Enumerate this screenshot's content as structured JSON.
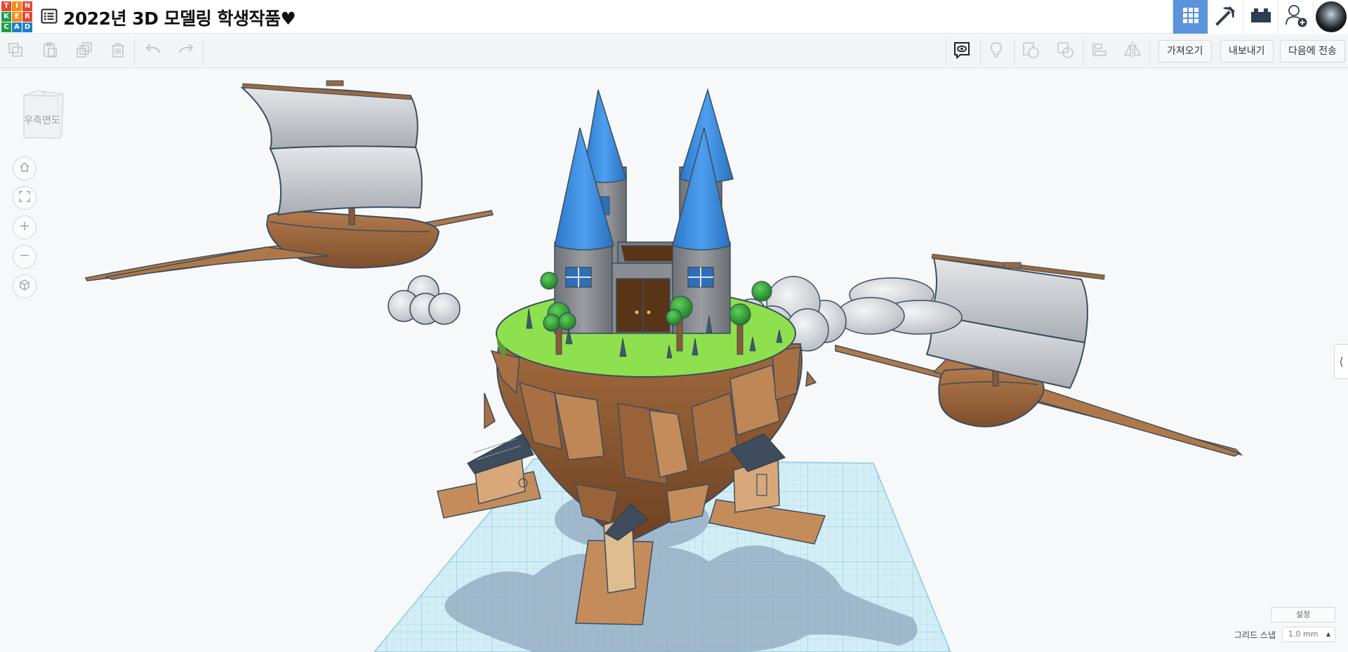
{
  "app": {
    "logo_letters": [
      "T",
      "I",
      "N",
      "K",
      "E",
      "R",
      "C",
      "A",
      "D"
    ],
    "logo_colors": [
      "#e8442f",
      "#f28c1e",
      "#e8442f",
      "#1f9e4a",
      "#f28c1e",
      "#e8442f",
      "#1f9e4a",
      "#1e7fc4",
      "#1e7fc4"
    ],
    "document_title": "2022년 3D 모델링 학생작품♥"
  },
  "top_right": {
    "items": [
      {
        "name": "3d-design-view",
        "icon": "grid-icon",
        "active": true
      },
      {
        "name": "blocks-view",
        "icon": "pickaxe-icon",
        "active": false
      },
      {
        "name": "bricks-view",
        "icon": "brick-icon",
        "active": false
      },
      {
        "name": "add-user",
        "icon": "add-user-icon",
        "active": false
      }
    ]
  },
  "toolbar": {
    "left_icons": [
      "copy-icon",
      "paste-icon",
      "duplicate-icon",
      "delete-icon",
      "undo-icon",
      "redo-icon"
    ],
    "right_icons": [
      "show-notes-icon",
      "light-bulb-icon",
      "shape-icon",
      "group-icon",
      "align-icon",
      "mirror-icon"
    ],
    "import_label": "가져오기",
    "export_label": "내보내기",
    "send_to_label": "다음에 전송"
  },
  "workplane": {
    "view_cube_label": "우측면도",
    "nav_buttons": [
      "home-icon",
      "fit-view-icon",
      "zoom-in-icon",
      "zoom-out-icon",
      "perspective-icon"
    ],
    "settings_label": "설정",
    "grid_snap_label": "그리드 스냅",
    "grid_snap_value": "1.0 mm"
  },
  "colors": {
    "accent": "#5b93dc",
    "sky_blue": "#3b8de0",
    "grass": "#8ee04e",
    "earth": "#b37a4c",
    "workplane_grid": "#aedcec",
    "shadow": "#8fa7bd",
    "stone": "#8a8d91"
  }
}
